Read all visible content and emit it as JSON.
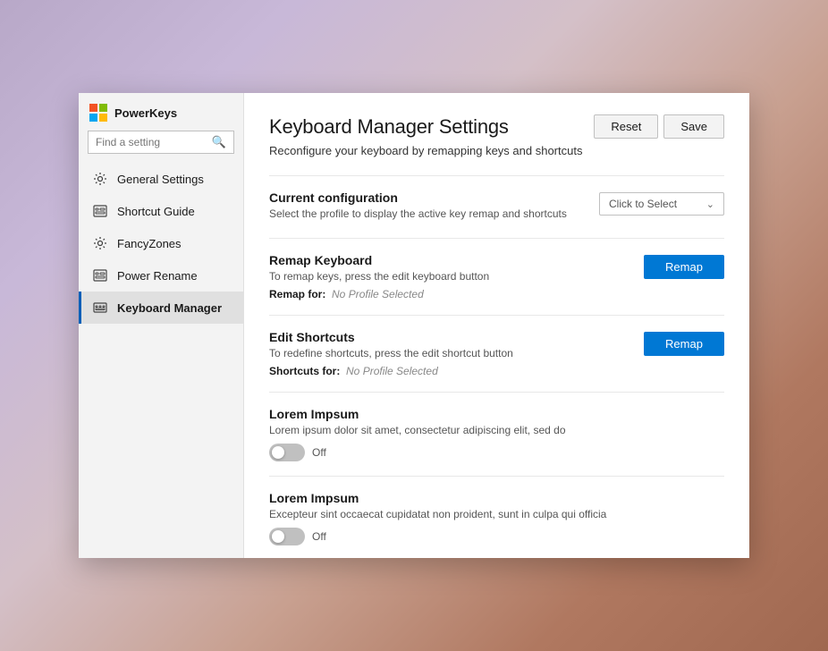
{
  "app": {
    "title": "PowerKeys",
    "logo_icon": "⊞"
  },
  "sidebar": {
    "search_placeholder": "Find a setting",
    "search_icon": "🔍",
    "items": [
      {
        "id": "general",
        "label": "General Settings",
        "icon": "⚙",
        "active": false
      },
      {
        "id": "shortcut-guide",
        "label": "Shortcut Guide",
        "icon": "⊞",
        "active": false
      },
      {
        "id": "fancyzones",
        "label": "FancyZones",
        "icon": "⚙",
        "active": false
      },
      {
        "id": "power-rename",
        "label": "Power Rename",
        "icon": "⊞",
        "active": false
      },
      {
        "id": "keyboard-manager",
        "label": "Keyboard Manager",
        "icon": "⊞",
        "active": true
      }
    ]
  },
  "main": {
    "title": "Keyboard Manager Settings",
    "subtitle": "Reconfigure your keyboard by remapping keys and shortcuts",
    "buttons": {
      "reset": "Reset",
      "save": "Save"
    },
    "sections": [
      {
        "id": "current-config",
        "title": "Current configuration",
        "desc": "Select the profile to display the active key remap and shortcuts",
        "control_type": "dropdown",
        "dropdown_label": "Click to Select"
      },
      {
        "id": "remap-keyboard",
        "title": "Remap Keyboard",
        "desc": "To remap keys, press the edit keyboard button",
        "sub_label": "Remap for:",
        "sub_value": "No Profile Selected",
        "control_type": "button",
        "button_label": "Remap"
      },
      {
        "id": "edit-shortcuts",
        "title": "Edit Shortcuts",
        "desc": "To redefine shortcuts, press the edit shortcut button",
        "sub_label": "Shortcuts for:",
        "sub_value": "No Profile Selected",
        "control_type": "button",
        "button_label": "Remap"
      },
      {
        "id": "lorem-1",
        "title": "Lorem Impsum",
        "desc": "Lorem ipsum dolor sit amet, consectetur adipiscing elit, sed do",
        "control_type": "toggle",
        "toggle_state": false,
        "toggle_label": "Off"
      },
      {
        "id": "lorem-2",
        "title": "Lorem Impsum",
        "desc": "Excepteur sint occaecat cupidatat non proident, sunt in culpa qui officia",
        "control_type": "toggle",
        "toggle_state": false,
        "toggle_label": "Off"
      }
    ]
  }
}
